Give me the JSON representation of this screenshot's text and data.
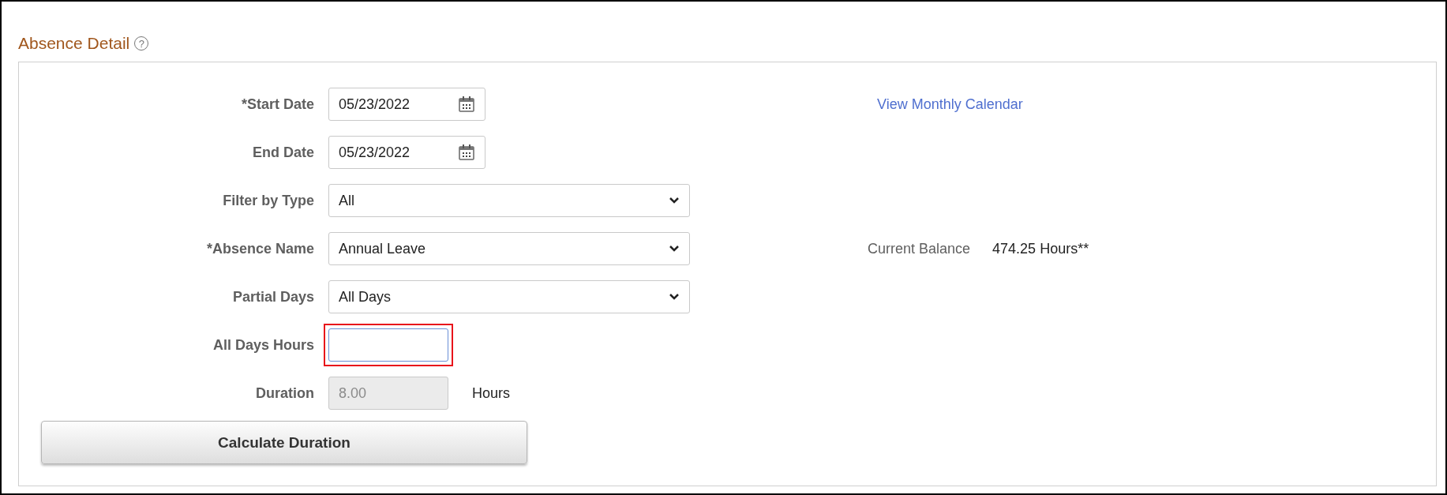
{
  "section": {
    "title": "Absence Detail",
    "help": "?"
  },
  "fields": [
    {
      "kind": "date",
      "label": "*Start Date",
      "value": "05/23/2022",
      "disabled": false,
      "highlighted": false,
      "side": {
        "kind": "link",
        "text": "View Monthly Calendar"
      }
    },
    {
      "kind": "date",
      "label": "End Date",
      "value": "05/23/2022",
      "disabled": false,
      "highlighted": false
    },
    {
      "kind": "select",
      "label": "Filter by Type",
      "value": "All",
      "disabled": false,
      "highlighted": false
    },
    {
      "kind": "select",
      "label": "*Absence Name",
      "value": "Annual Leave",
      "disabled": false,
      "highlighted": false,
      "side": {
        "kind": "balance",
        "label": "Current Balance",
        "text": "474.25 Hours**"
      }
    },
    {
      "kind": "select",
      "label": "Partial Days",
      "value": "All Days",
      "disabled": false,
      "highlighted": false
    },
    {
      "kind": "text",
      "label": "All Days Hours",
      "disabled": false,
      "highlighted": true
    },
    {
      "kind": "text",
      "label": "Duration",
      "value": "8.00",
      "unit": "Hours",
      "disabled": true,
      "highlighted": false
    }
  ],
  "button": "Calculate Duration"
}
